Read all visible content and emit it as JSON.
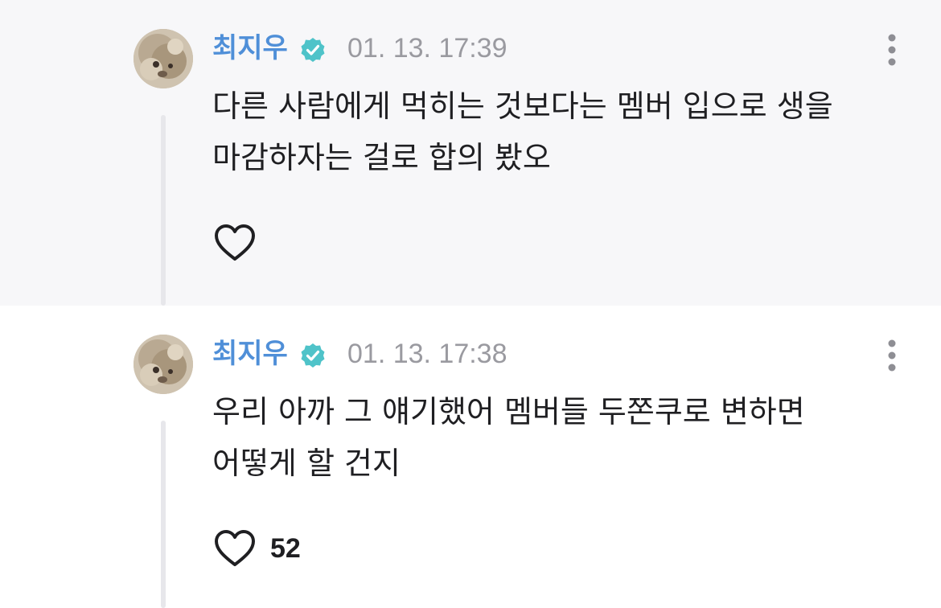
{
  "comments": [
    {
      "author": "최지우",
      "timestamp": "01. 13. 17:39",
      "text": "다른 사람에게 먹히는 것보다는 멤버 입으로 생을\n마감하자는 걸로 합의 봤오",
      "likes": "",
      "verified": true
    },
    {
      "author": "최지우",
      "timestamp": "01. 13. 17:38",
      "text": "우리 아까 그 얘기했어 멤버들 두쫀쿠로 변하면\n어떻게 할 건지",
      "likes": "52",
      "verified": true
    }
  ],
  "icons": {
    "verified": "verified-badge-icon",
    "like": "heart-outline-icon",
    "more": "more-vertical-icon"
  },
  "colors": {
    "author": "#4f8fd8",
    "verified_badge": "#4fc3c9",
    "timestamp": "#9a9aa0",
    "text": "#1f1f22",
    "highlight_bg": "#f7f7f9"
  }
}
